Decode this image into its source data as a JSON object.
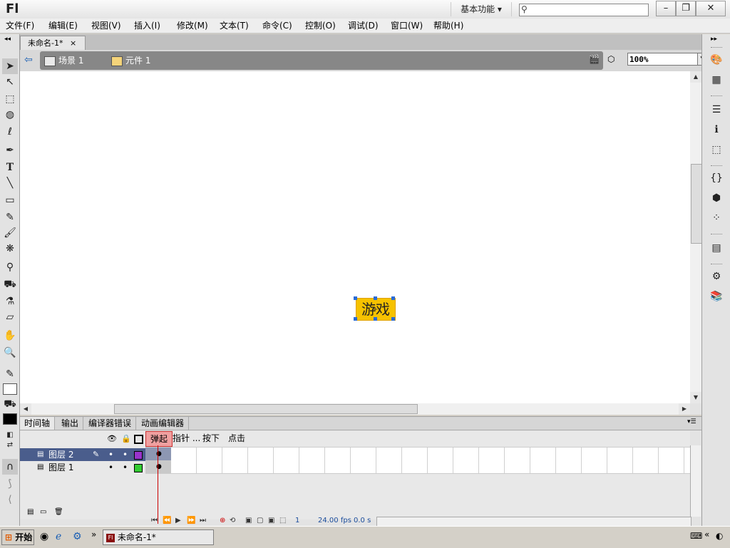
{
  "app": {
    "logo": "Fl",
    "workspace": "基本功能",
    "search_placeholder": ""
  },
  "window_controls": {
    "minimize": "–",
    "restore": "❐",
    "close": "✕"
  },
  "menu": [
    "文件(F)",
    "编辑(E)",
    "视图(V)",
    "插入(I)",
    "修改(M)",
    "文本(T)",
    "命令(C)",
    "控制(O)",
    "调试(D)",
    "窗口(W)",
    "帮助(H)"
  ],
  "document_tab": {
    "label": "未命名-1*",
    "close": "×"
  },
  "breadcrumb": {
    "scene": "场景 1",
    "symbol": "元件 1"
  },
  "zoom": "100%",
  "stage": {
    "button_text": "游戏",
    "button_color": "#f6c200"
  },
  "timeline": {
    "tabs": [
      "时间轴",
      "输出",
      "编译器错误",
      "动画编辑器"
    ],
    "frame_labels": [
      "弹起",
      "指针 ...",
      "按下",
      "点击"
    ],
    "layers": [
      {
        "name": "图层 2",
        "selected": true,
        "color": "#9933cc"
      },
      {
        "name": "图层 1",
        "selected": false,
        "color": "#33cc33"
      }
    ],
    "status": {
      "current_frame": "1",
      "fps": "24.00",
      "fps_unit": "fps",
      "time": "0.0 s"
    }
  },
  "taskbar": {
    "start": "开始",
    "task_item": "未命名-1*",
    "chevron": "»"
  }
}
